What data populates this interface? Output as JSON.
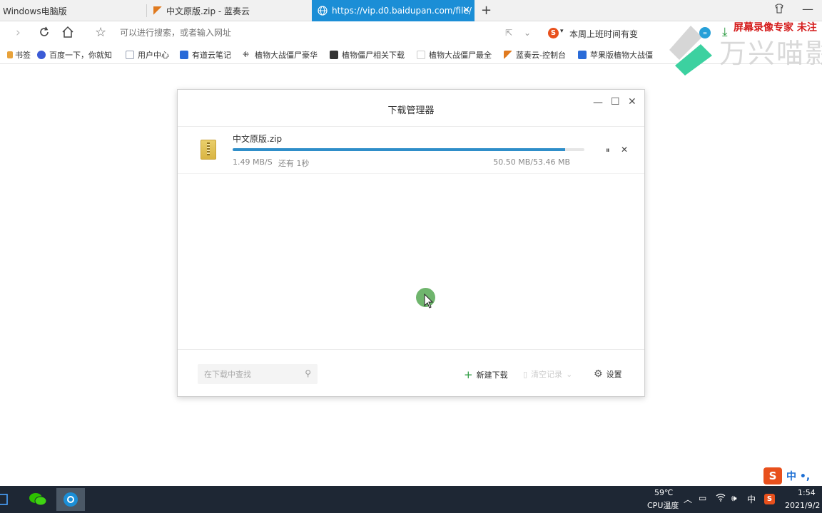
{
  "tabs": [
    {
      "label": "Windows电脑版",
      "active": false
    },
    {
      "label": "中文原版.zip - 蓝奏云",
      "active": false
    },
    {
      "label": "https://vip.d0.baidupan.com/file/",
      "active": true
    }
  ],
  "addressbar": {
    "placeholder": "可以进行搜索，或者输入网址",
    "search_hint": "本周上班时间有变"
  },
  "bookmarks": [
    {
      "label": "书签",
      "color": "#e8a23a"
    },
    {
      "label": "百度一下，你就知",
      "color": "#3b5bd6"
    },
    {
      "label": "用户中心",
      "color": "#9aa3b5"
    },
    {
      "label": "有道云笔记",
      "color": "#2a6bd8"
    },
    {
      "label": "植物大战僵尸豪华",
      "color": "#222222"
    },
    {
      "label": "植物僵尸相关下载",
      "color": "#333333"
    },
    {
      "label": "植物大战僵尸最全",
      "color": "#cccccc"
    },
    {
      "label": "蓝奏云-控制台",
      "color": "#e07a1f"
    },
    {
      "label": "苹果版植物大战僵",
      "color": "#2a6bd8"
    }
  ],
  "watermark": {
    "red_text": "屏幕录像专家 未注",
    "brand_text": "万兴喵影"
  },
  "dialog": {
    "title": "下载管理器",
    "item": {
      "file_name": "中文原版.zip",
      "speed": "1.49 MB/S",
      "remaining": "还有 1秒",
      "size": "50.50 MB/53.46 MB",
      "progress_fraction": 0.945
    },
    "search_placeholder": "在下载中查找",
    "new_download_label": "新建下载",
    "clear_label": "清空记录",
    "settings_label": "设置"
  },
  "ime": {
    "label": "中 •,"
  },
  "taskbar": {
    "temperature": "59℃",
    "cpu_label": "CPU温度",
    "ime_lang": "中",
    "time": "1:54",
    "date": "2021/9/2"
  },
  "colors": {
    "accent": "#1b8ed6",
    "progress": "#2f8ec9",
    "watermark_red": "#d41b1b",
    "taskbar": "#1e2734"
  }
}
